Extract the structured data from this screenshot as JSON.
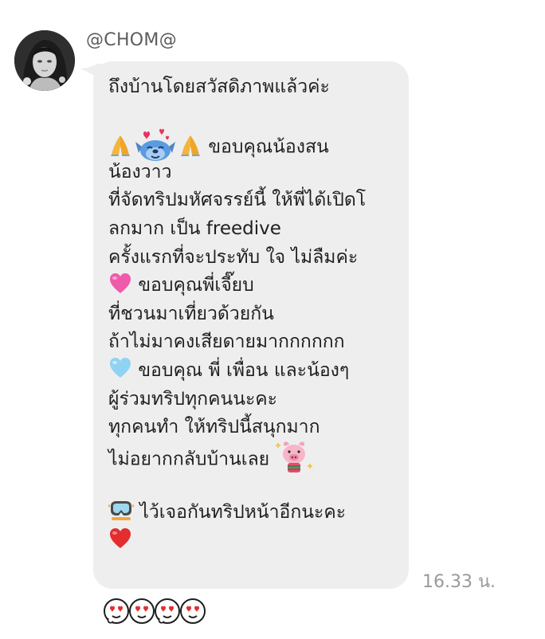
{
  "chat": {
    "sender_name": "@CHOM@",
    "timestamp": "16.33 น.",
    "message_lines": [
      "ถึงบ้านโดยสวัสดิภาพแล้วค่ะ",
      "",
      "ขอบคุณน้องสน",
      "น้องวาว",
      "ที่จัดทริปมหัศจรรย์นี้ ให้พี่ได้เปิดโ",
      "ลกมาก เป็น freedive",
      "ครั้งแรกที่จะประทับ ใจ ไม่ลืมค่ะ",
      "ขอบคุณพี่เจี๊ยบ",
      "ที่ชวนมาเที่ยวด้วยกัน",
      "ถ้าไม่มาคงเสียดายมากกกกกก",
      "ขอบคุณ พี่ เพื่อน และน้องๆ",
      "ผู้ร่วมทริปทุกคนนะคะ",
      "ทุกคนทำ ให้ทริปนี้สนุกมาก",
      "ไม่อยากกลับบ้านเลย",
      "",
      "ไว้เจอกันทริปหน้าอีกนะคะ",
      ""
    ],
    "emoji_names": {
      "pray": "folded-hands-emoji",
      "stitch": "stitch-hearts-sticker",
      "pink_heart": "pink-heart-emoji",
      "blue_heart": "light-blue-heart-emoji",
      "piglet": "piglet-sticker",
      "mask": "diving-mask-emoji",
      "red_heart": "red-heart-emoji",
      "stickers": "heart-eyes-stickers"
    }
  },
  "colors": {
    "bubble": "#eeeeef",
    "text": "#1f1f1f",
    "sender": "#5c5c5c",
    "timestamp": "#9a9a9a",
    "background": "#ffffff"
  }
}
